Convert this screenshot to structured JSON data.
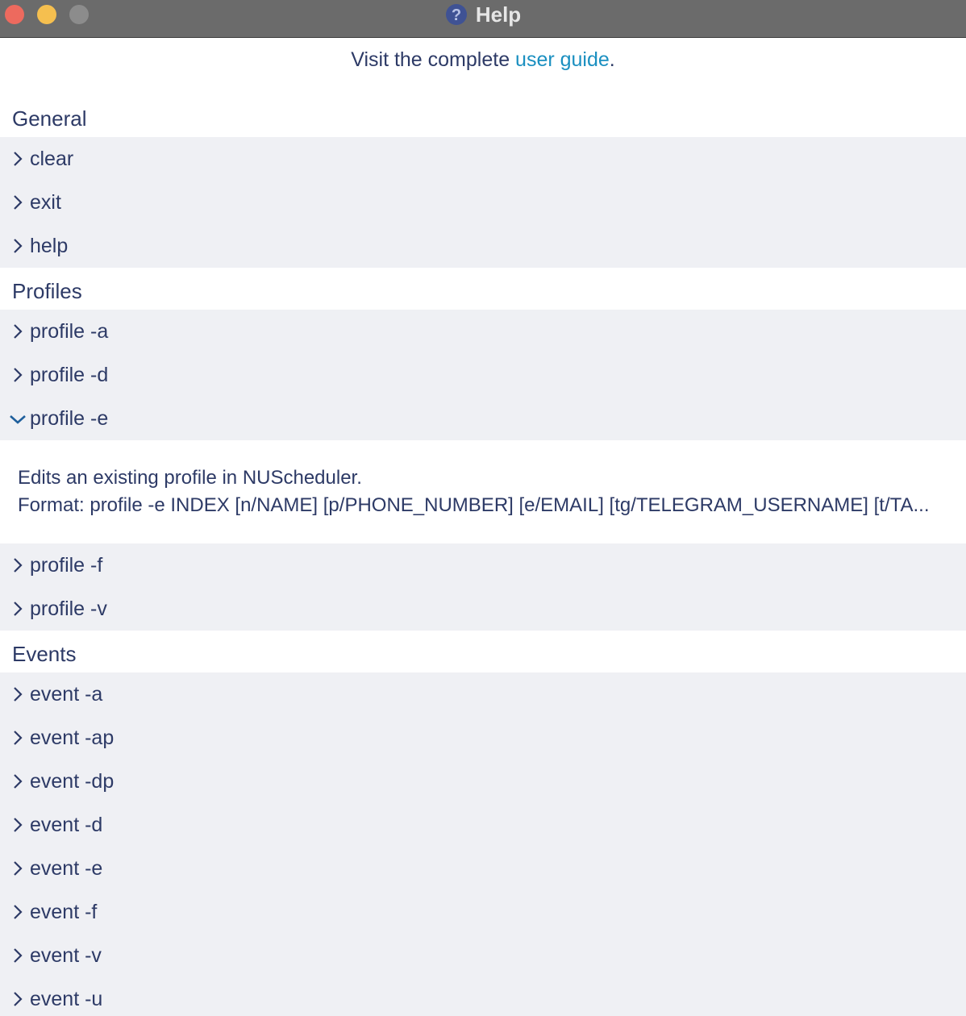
{
  "window": {
    "title": "Help"
  },
  "guide": {
    "prefix": "Visit the complete ",
    "link": "user guide",
    "suffix": "."
  },
  "sections": {
    "general": {
      "title": "General",
      "items": [
        "clear",
        "exit",
        "help"
      ]
    },
    "profiles": {
      "title": "Profiles",
      "items": [
        "profile -a",
        "profile -d",
        "profile -e",
        "profile -f",
        "profile -v"
      ],
      "expanded": "profile -e",
      "description": "Edits an existing profile in NUScheduler.",
      "format": "Format: profile -e INDEX [n/NAME] [p/PHONE_NUMBER] [e/EMAIL] [tg/TELEGRAM_USERNAME] [t/TA..."
    },
    "events": {
      "title": "Events",
      "items": [
        "event -a",
        "event -ap",
        "event -dp",
        "event -d",
        "event -e",
        "event -f",
        "event -v",
        "event -u"
      ]
    }
  },
  "colors": {
    "accent": "#1a8fc0",
    "text": "#2d3a66",
    "rowBg": "#eff0f4"
  }
}
